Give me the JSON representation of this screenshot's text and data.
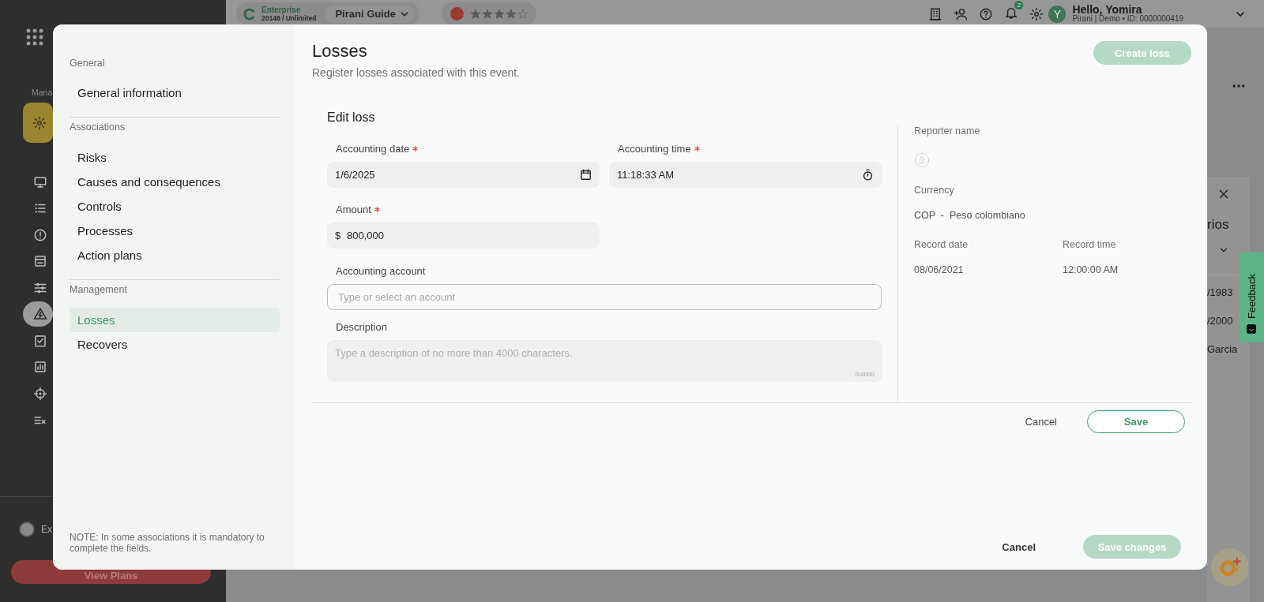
{
  "topbar": {
    "plan": "Enterprise",
    "plan_usage": "20148 / Unlimited",
    "guide": "Pirani Guide",
    "stars": 4,
    "notifications": "2",
    "avatar": "Y",
    "greeting": "Hello, Yomira",
    "account": "Pirani | Demo • ID: 0000000419"
  },
  "sidebar": {
    "section_label": "Mana",
    "items": [
      {
        "kind": "monitor",
        "selected": false
      },
      {
        "kind": "list",
        "selected": false
      },
      {
        "kind": "alert",
        "selected": false
      },
      {
        "kind": "archive",
        "selected": false
      },
      {
        "kind": "sliders",
        "selected": false
      },
      {
        "kind": "warning",
        "selected": true
      },
      {
        "kind": "checklist",
        "selected": false
      },
      {
        "kind": "chart",
        "selected": false
      },
      {
        "kind": "target",
        "selected": false
      },
      {
        "kind": "list-x",
        "selected": false
      }
    ],
    "explore": "Ex",
    "plans_button": "View Plans"
  },
  "background_panel": {
    "heading": "rios",
    "rows": [
      "/1983",
      "/2000",
      "Garcia"
    ]
  },
  "feedback": "Feedback",
  "modal": {
    "nav": [
      {
        "heading": "General",
        "items": [
          {
            "label": "General information",
            "selected": false
          }
        ]
      },
      {
        "heading": "Associations",
        "items": [
          {
            "label": "Risks",
            "selected": false
          },
          {
            "label": "Causes and consequences",
            "selected": false
          },
          {
            "label": "Controls",
            "selected": false
          },
          {
            "label": "Processes",
            "selected": false
          },
          {
            "label": "Action plans",
            "selected": false
          }
        ]
      },
      {
        "heading": "Management",
        "items": [
          {
            "label": "Losses",
            "selected": true
          },
          {
            "label": "Recovers",
            "selected": false
          }
        ]
      }
    ],
    "note": "NOTE: In some associations it is mandatory to complete the fields.",
    "title": "Losses",
    "subtitle": "Register losses associated with this event.",
    "create_button": {
      "label": "Create loss",
      "disabled": true
    },
    "form": {
      "title": "Edit loss",
      "fields": [
        {
          "kind": "date",
          "label": "Accounting date",
          "required": true,
          "value": "1/6/2025"
        },
        {
          "kind": "time",
          "label": "Accounting time",
          "required": true,
          "value": "11:18:33 AM"
        },
        {
          "kind": "amount",
          "label": "Amount",
          "required": true,
          "prefix": "$",
          "value": "800,000"
        },
        {
          "kind": "select",
          "label": "Accounting account",
          "required": false,
          "placeholder": "Type or select an account"
        },
        {
          "kind": "textarea",
          "label": "Description",
          "required": false,
          "placeholder": "Type a description of no more than 4000 characters.",
          "counter": "0/4000"
        }
      ],
      "info": {
        "reporter_label": "Reporter name",
        "currency_label": "Currency",
        "currency": "COP  -  Peso colombiano",
        "record_date_label": "Record date",
        "record_date": "08/06/2021",
        "record_time_label": "Record time",
        "record_time": "12:00:00 AM"
      },
      "cancel": "Cancel",
      "save": "Save"
    },
    "footer": {
      "cancel": "Cancel",
      "save": {
        "label": "Save changes",
        "disabled": true
      }
    }
  }
}
